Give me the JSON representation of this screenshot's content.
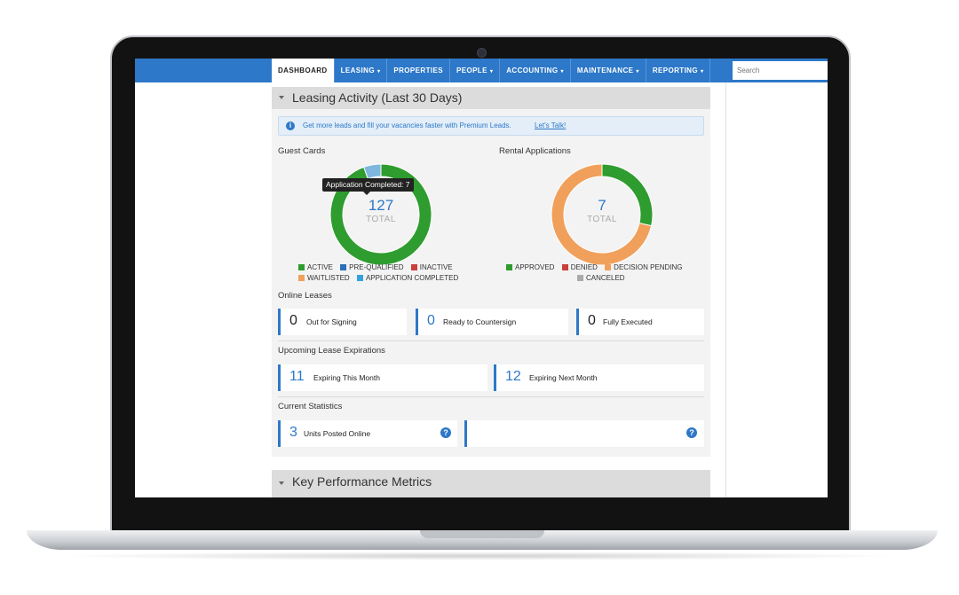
{
  "nav": {
    "items": [
      {
        "label": "DASHBOARD",
        "caret": ""
      },
      {
        "label": "LEASING",
        "caret": "▾"
      },
      {
        "label": "PROPERTIES",
        "caret": ""
      },
      {
        "label": "PEOPLE",
        "caret": "▾"
      },
      {
        "label": "ACCOUNTING",
        "caret": "▾"
      },
      {
        "label": "MAINTENANCE",
        "caret": "▾"
      },
      {
        "label": "REPORTING",
        "caret": "▾"
      }
    ],
    "search_placeholder": "Search"
  },
  "leasing_panel": {
    "title": "Leasing Activity (Last 30 Days)",
    "alert_text": "Get more leads and fill your vacancies faster with Premium Leads.",
    "alert_link": "Let's Talk!"
  },
  "guest_cards": {
    "title": "Guest Cards",
    "total": "127",
    "total_label": "TOTAL",
    "tooltip": "Application Completed: 7",
    "legend": [
      "ACTIVE",
      "PRE-QUALIFIED",
      "INACTIVE",
      "WAITLISTED",
      "APPLICATION COMPLETED"
    ]
  },
  "rental_applications": {
    "title": "Rental Applications",
    "total": "7",
    "total_label": "TOTAL",
    "legend": [
      "APPROVED",
      "DENIED",
      "DECISION PENDING",
      "CANCELED"
    ]
  },
  "chart_data": [
    {
      "type": "pie",
      "title": "Guest Cards",
      "categories": [
        "ACTIVE",
        "PRE-QUALIFIED",
        "INACTIVE",
        "WAITLISTED",
        "APPLICATION COMPLETED"
      ],
      "values": [
        120,
        0,
        0,
        0,
        7
      ],
      "colors": [
        "#2e9c2e",
        "#2d6fb8",
        "#c9413b",
        "#f0a05a",
        "#7fb6de"
      ]
    },
    {
      "type": "pie",
      "title": "Rental Applications",
      "categories": [
        "APPROVED",
        "DENIED",
        "DECISION PENDING",
        "CANCELED"
      ],
      "values": [
        2,
        0,
        5,
        0
      ],
      "colors": [
        "#2e9c2e",
        "#c9413b",
        "#f0a05a",
        "#aaaaaa"
      ]
    }
  ],
  "online_leases": {
    "title": "Online Leases",
    "stats": [
      {
        "value": "0",
        "label": "Out for Signing"
      },
      {
        "value": "0",
        "label": "Ready to Countersign"
      },
      {
        "value": "0",
        "label": "Fully Executed"
      }
    ]
  },
  "lease_expirations": {
    "title": "Upcoming Lease Expirations",
    "stats": [
      {
        "value": "11",
        "label": "Expiring This Month"
      },
      {
        "value": "12",
        "label": "Expiring Next Month"
      }
    ]
  },
  "current_statistics": {
    "title": "Current Statistics",
    "stats": [
      {
        "value": "3",
        "label": "Units Posted Online"
      }
    ],
    "help_glyph": "?"
  },
  "kpi_panel": {
    "title": "Key Performance Metrics"
  },
  "icons": {
    "info": "i",
    "collapse": "triangle-down"
  },
  "colors": {
    "brand_blue": "#2d78c8",
    "active_green": "#2e9c2e",
    "pending_orange": "#f0a05a"
  }
}
